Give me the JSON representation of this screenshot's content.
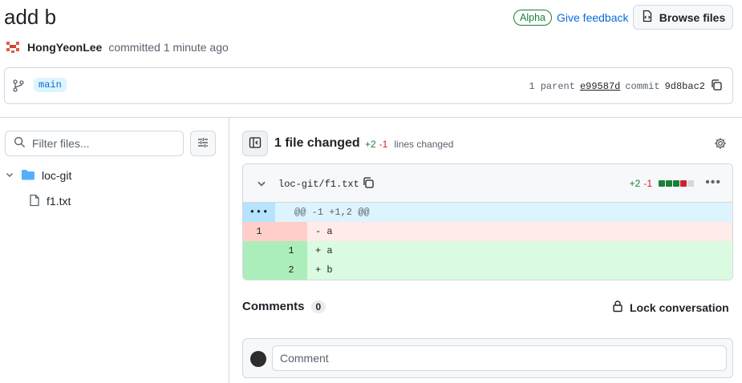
{
  "header": {
    "title": "add b",
    "alpha_badge": "Alpha",
    "feedback_link": "Give feedback",
    "browse_files": "Browse files"
  },
  "author": {
    "name": "HongYeonLee",
    "meta": "committed 1 minute ago"
  },
  "branch": {
    "name": "main",
    "parents_label": "1 parent",
    "parent_sha": "e99587d",
    "commit_label": "commit",
    "commit_sha": "9d8bac2"
  },
  "sidebar": {
    "filter_placeholder": "Filter files...",
    "tree": {
      "folder": "loc-git",
      "file": "f1.txt"
    }
  },
  "main": {
    "files_changed": "1 file changed",
    "additions": "+2",
    "deletions": "-1",
    "lines_changed": "lines changed"
  },
  "diff": {
    "file_path": "loc-git/f1.txt",
    "additions": "+2",
    "deletions": "-1",
    "hunk_expand": "•••",
    "hunk_header": "@@ -1 +1,2 @@",
    "rows": [
      {
        "type": "del",
        "old": "1",
        "new": "",
        "code": "- a"
      },
      {
        "type": "add",
        "old": "",
        "new": "1",
        "code": "+ a"
      },
      {
        "type": "add",
        "old": "",
        "new": "2",
        "code": "+ b"
      }
    ],
    "stat_blocks": [
      "add",
      "add",
      "add",
      "del",
      "neutral"
    ]
  },
  "comments": {
    "title": "Comments",
    "count": "0",
    "lock_label": "Lock conversation",
    "input_placeholder": "Comment"
  },
  "colors": {
    "accent": "#0969da",
    "add": "#1a7f37",
    "del": "#d1242f"
  }
}
